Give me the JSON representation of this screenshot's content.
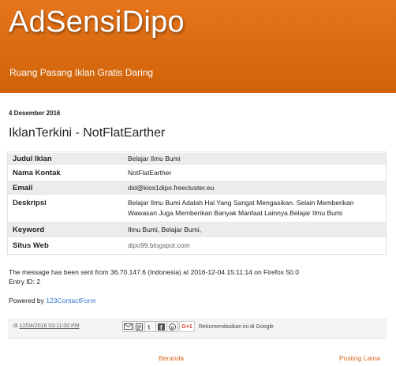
{
  "header": {
    "title": "AdSensiDipo",
    "description": "Ruang Pasang Iklan Gratis Daring"
  },
  "post": {
    "date": "4 Desember 2016",
    "title": "IklanTerkini - NotFlatEarther",
    "fields": [
      {
        "label": "Judul Iklan",
        "value": "Belajar Ilmu Bumi"
      },
      {
        "label": "Nama Kontak",
        "value": "NotFlatEarther"
      },
      {
        "label": "Email",
        "value": "did@kios1dipo.freecluster.eu"
      },
      {
        "label": "Deskripsi",
        "value_line1": "Belajar Ilmu Bumi Adalah Hal Yang Sangat Mengasikan. Selain Memberikan",
        "value_line2": "Wawasan Juga Memberikan Banyak Manfaat Lainnya.Belajar Ilmu Bumi"
      },
      {
        "label": "Keyword",
        "value": "Ilmu Bumi, Belajar Bumi,"
      },
      {
        "label": "Situs Web",
        "value": "dipo99.blogspot.com"
      }
    ],
    "message_line1": "The message has been sent from 36.70.147.6 (Indonesia) at 2016-12-04 15:11:14 on Firefox 50.0",
    "message_line2": "Entry ID: 2",
    "powered_prefix": "Powered by",
    "powered_link": "123ContactForm"
  },
  "footer": {
    "posted_prefix": "di",
    "posted_time": "12/04/2016 03:11:00 PM",
    "plusone_label": "G+1",
    "recommend_text": "Rekomendasikan ini di Google",
    "share_icons": [
      "email-icon",
      "blog-this-icon",
      "twitter-icon",
      "facebook-icon",
      "pinterest-icon"
    ]
  },
  "nav": {
    "home": "Beranda",
    "older": "Posting Lama"
  },
  "colors": {
    "header_orange": "#d96a10",
    "link_blue": "#3778cd",
    "nav_orange": "#d9641a"
  }
}
